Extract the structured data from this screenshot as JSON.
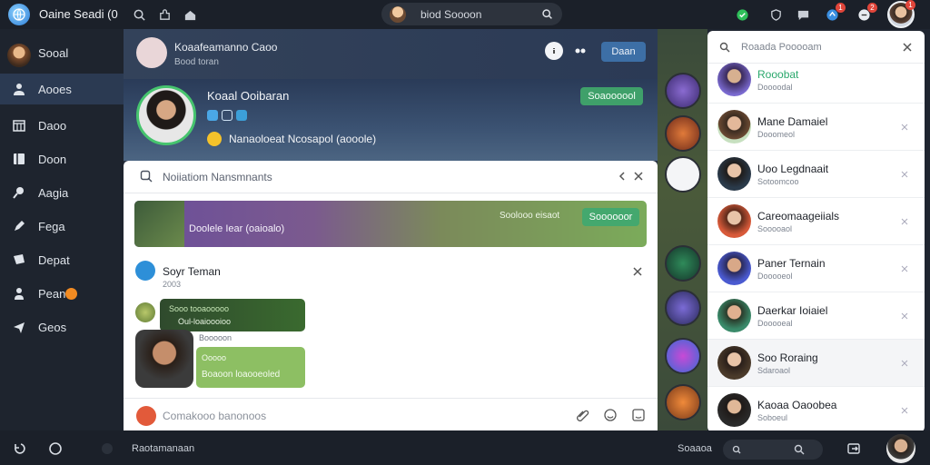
{
  "header": {
    "app_title": "Oaine Seadi (0",
    "search_query": "biod Soooon",
    "badges": {
      "notif_a": "1",
      "notif_b": "2",
      "notif_c": "1"
    }
  },
  "sidebar": {
    "items": [
      {
        "label": "Sooal",
        "icon": "avatar-icon"
      },
      {
        "label": "Aooes",
        "icon": "user-icon"
      },
      {
        "label": "Daoo",
        "icon": "building-icon"
      },
      {
        "label": "Doon",
        "icon": "book-icon"
      },
      {
        "label": "Aagia",
        "icon": "pin-icon"
      },
      {
        "label": "Fega",
        "icon": "pencil-icon"
      },
      {
        "label": "Depat",
        "icon": "chat-icon"
      },
      {
        "label": "Pean",
        "icon": "person-icon"
      },
      {
        "label": "Geos",
        "icon": "send-icon"
      }
    ]
  },
  "profile": {
    "name": "Koaafeamanno Caoo",
    "subtitle": "Bood toran",
    "action_label": "Daan"
  },
  "hero": {
    "name": "Koaal Ooibaran",
    "status": "Nanaoloeat Ncosapol (aooole)",
    "follow_label": "Soaoooool"
  },
  "panel": {
    "title": "Noiiatiom Nansmnants",
    "banner_text": "Doolele Iear (oaioalo)",
    "banner_meta": "Soolooo eisaot",
    "banner_button": "Soooooor",
    "chat_title": "Soyr Teman",
    "chat_sub": "2003",
    "bubble1_top": "Sooo tooaooooo",
    "bubble1_bottom": "Oul-loaioooioo",
    "bubble2_meta": "Booooon",
    "bubble2_top": "Ooooo",
    "bubble2_bottom": "Boaoon loaooeoled",
    "composer_placeholder": "Comakooo banonoos"
  },
  "contacts_panel": {
    "search_placeholder": "Roaada Pooooam",
    "contacts": [
      {
        "name": "Rooobat",
        "status": "Doooodal",
        "name_color": "#2aa86c"
      },
      {
        "name": "Mane Damaiel",
        "status": "Dooomeol",
        "name_color": "#1d2128"
      },
      {
        "name": "Uoo Legdnaait",
        "status": "Sotoomcoo",
        "name_color": "#1d2128"
      },
      {
        "name": "Careomaageiials",
        "status": "Sooooaol",
        "name_color": "#1d2128"
      },
      {
        "name": "Paner Ternain",
        "status": "Dooooeol",
        "name_color": "#1d2128"
      },
      {
        "name": "Daerkar Ioiaiel",
        "status": "Dooooeal",
        "name_color": "#1d2128"
      },
      {
        "name": "Soo Roraing",
        "status": "Sdaroaol",
        "name_color": "#1d2128"
      },
      {
        "name": "Kaoaa Oaoobea",
        "status": "Soboeul",
        "name_color": "#1d2128"
      }
    ]
  },
  "bottombar": {
    "label": "Raotamanaan",
    "label2": "Soaaoa"
  },
  "colors": {
    "accent_green": "#3fa06a",
    "accent_blue": "#3d6fa6",
    "sidebar_active": "#2b3a52"
  }
}
